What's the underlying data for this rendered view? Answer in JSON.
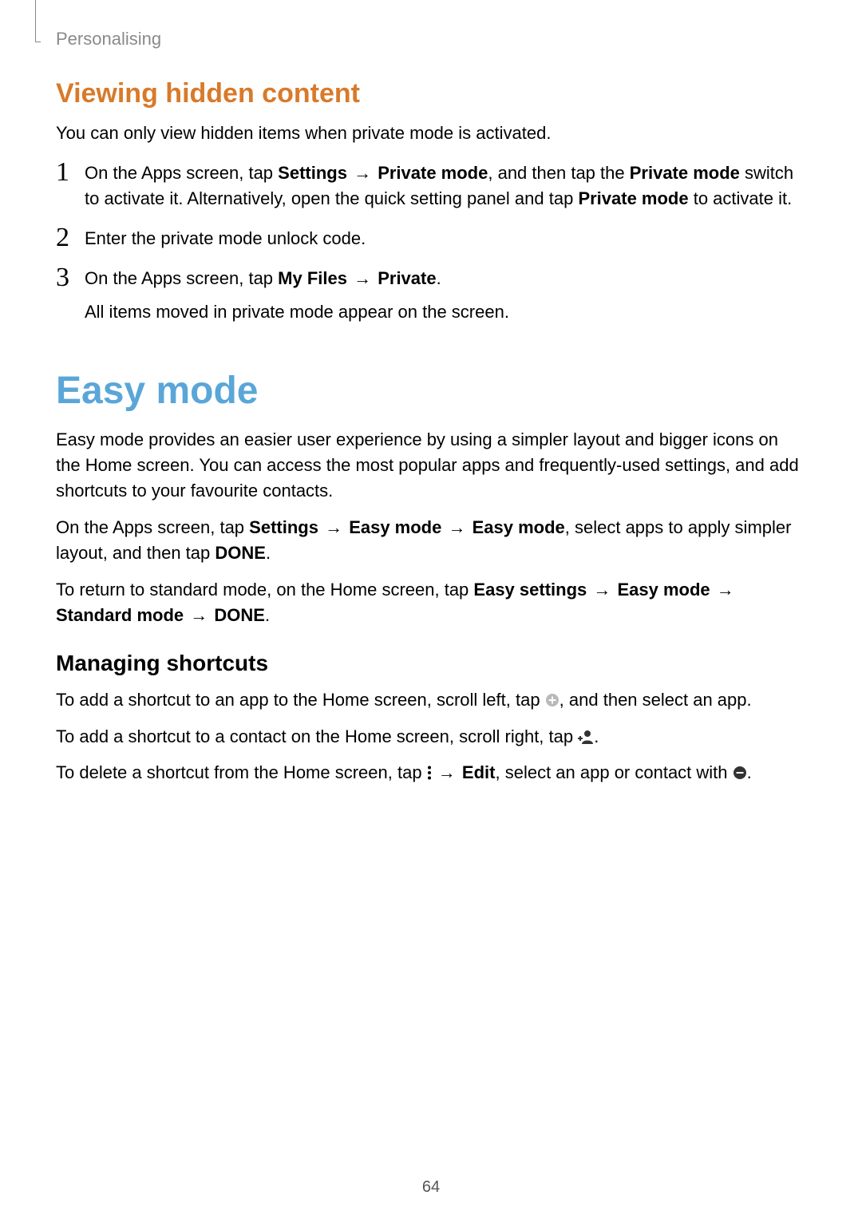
{
  "breadcrumb": "Personalising",
  "section1": {
    "heading": "Viewing hidden content",
    "intro": "You can only view hidden items when private mode is activated.",
    "steps": [
      {
        "num": "1",
        "pre": "On the Apps screen, tap ",
        "b1": "Settings",
        "arrow1": " → ",
        "b2": "Private mode",
        "mid": ", and then tap the ",
        "b3": "Private mode",
        "post": " switch to activate it. Alternatively, open the quick setting panel and tap ",
        "b4": "Private mode",
        "end": " to activate it."
      },
      {
        "num": "2",
        "text": "Enter the private mode unlock code."
      },
      {
        "num": "3",
        "pre": "On the Apps screen, tap ",
        "b1": "My Files",
        "arrow1": " → ",
        "b2": "Private",
        "post": ".",
        "line2": "All items moved in private mode appear on the screen."
      }
    ]
  },
  "section2": {
    "heading": "Easy mode",
    "para1": "Easy mode provides an easier user experience by using a simpler layout and bigger icons on the Home screen. You can access the most popular apps and frequently-used settings, and add shortcuts to your favourite contacts.",
    "para2": {
      "pre": "On the Apps screen, tap ",
      "b1": "Settings",
      "arrow1": " → ",
      "b2": "Easy mode",
      "arrow2": " → ",
      "b3": "Easy mode",
      "mid": ", select apps to apply simpler layout, and then tap ",
      "b4": "DONE",
      "post": "."
    },
    "para3": {
      "pre": "To return to standard mode, on the Home screen, tap ",
      "b1": "Easy settings",
      "arrow1": " → ",
      "b2": "Easy mode",
      "arrow2": " → ",
      "b3": "Standard mode",
      "arrow3": " → ",
      "b4": "DONE",
      "post": "."
    },
    "sub": "Managing shortcuts",
    "shortcut_add_app": {
      "pre": "To add a shortcut to an app to the Home screen, scroll left, tap ",
      "post": ", and then select an app."
    },
    "shortcut_add_contact": {
      "pre": "To add a shortcut to a contact on the Home screen, scroll right, tap ",
      "post": "."
    },
    "shortcut_delete": {
      "pre": "To delete a shortcut from the Home screen, tap ",
      "arrow": " → ",
      "b1": "Edit",
      "mid": ", select an app or contact with ",
      "post": "."
    }
  },
  "page_number": "64"
}
